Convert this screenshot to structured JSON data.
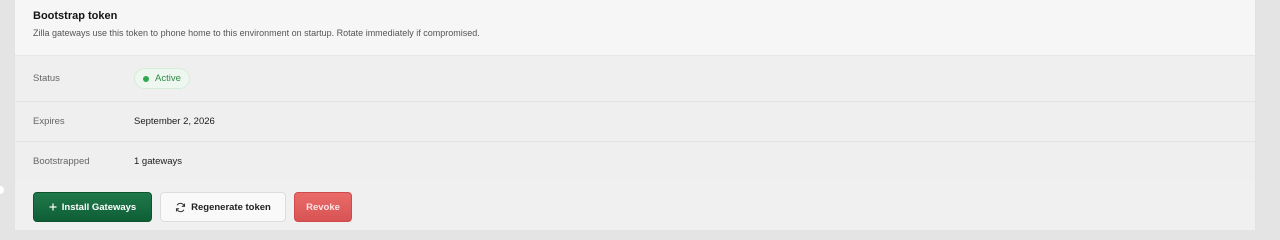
{
  "card": {
    "title": "Bootstrap token",
    "subtitle": "Zilla gateways use this token to phone home to this environment on startup. Rotate immediately if compromised."
  },
  "details": {
    "status_label": "Status",
    "status_value": "Active",
    "expires_label": "Expires",
    "expires_value": "September 2, 2026",
    "bootstrapped_label": "Bootstrapped",
    "bootstrapped_value": "1 gateways"
  },
  "actions": {
    "install_label": "Install Gateways",
    "install_icon": "plus-icon",
    "regenerate_label": "Regenerate token",
    "regenerate_icon": "refresh-icon",
    "revoke_label": "Revoke"
  },
  "colors": {
    "primary": "#0f5e36",
    "danger": "#d85454",
    "status_active": "#2fa84f"
  }
}
